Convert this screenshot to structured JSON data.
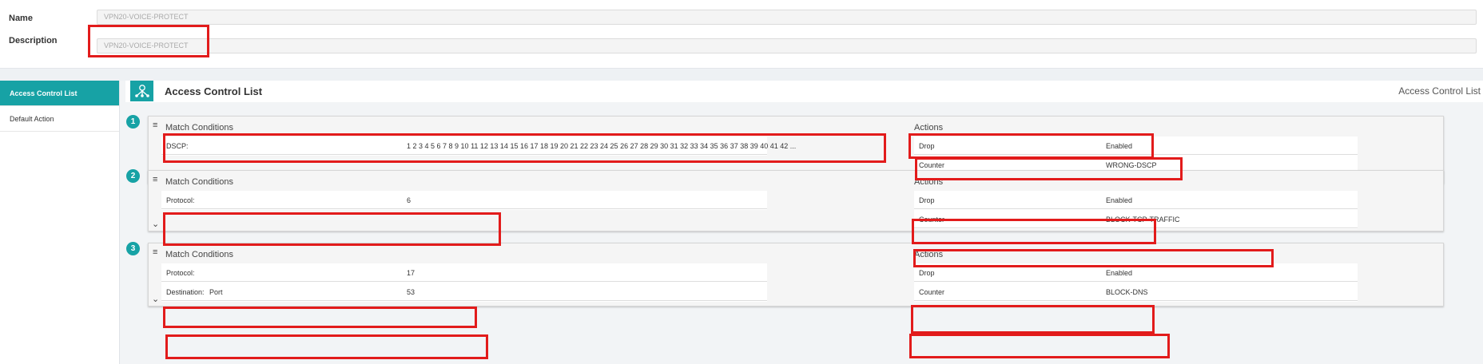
{
  "form": {
    "name_label": "Name",
    "name_value": "VPN20-VOICE-PROTECT",
    "description_label": "Description",
    "description_value": "VPN20-VOICE-PROTECT"
  },
  "sidebar": {
    "items": [
      {
        "label": "Access Control List"
      },
      {
        "label": "Default Action"
      }
    ]
  },
  "acl": {
    "title": "Access Control List",
    "title_right": "Access Control List"
  },
  "rules": [
    {
      "number": "1",
      "match_title": "Match Conditions",
      "actions_title": "Actions",
      "conditions": [
        {
          "label": "DSCP:",
          "value": "1 2 3 4 5 6 7 8 9 10 11 12 13 14 15 16 17 18 19 20 21 22 23 24 25 26 27 28 29 30 31 32 33 34 35 36 37 38 39 40 41 42 ..."
        }
      ],
      "actions": [
        {
          "label": "Drop",
          "value": "Enabled"
        },
        {
          "label": "Counter",
          "value": "WRONG-DSCP"
        }
      ]
    },
    {
      "number": "2",
      "match_title": "Match Conditions",
      "actions_title": "Actions",
      "conditions": [
        {
          "label": "Protocol:",
          "value": "6"
        }
      ],
      "actions": [
        {
          "label": "Drop",
          "value": "Enabled"
        },
        {
          "label": "Counter",
          "value": "BLOCK-TCP-TRAFFIC"
        }
      ]
    },
    {
      "number": "3",
      "match_title": "Match Conditions",
      "actions_title": "Actions",
      "conditions": [
        {
          "label": "Protocol:",
          "value": "17"
        },
        {
          "label": "Destination:",
          "sub_label": "Port",
          "value": "53"
        }
      ],
      "actions": [
        {
          "label": "Drop",
          "value": "Enabled"
        },
        {
          "label": "Counter",
          "value": "BLOCK-DNS"
        }
      ]
    }
  ],
  "colors": {
    "accent": "#17a2a5",
    "highlight": "#e21b1b"
  },
  "icons": {
    "acl": "acl-network-icon",
    "menu": "hamburger-icon",
    "expand": "chevron-down-icon"
  }
}
